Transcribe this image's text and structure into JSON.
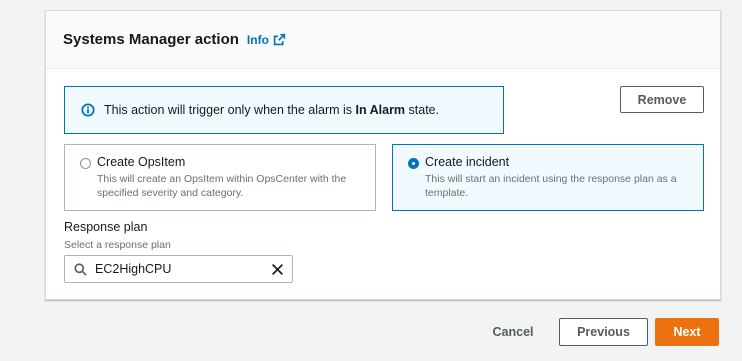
{
  "panel": {
    "title": "Systems Manager action",
    "info_link": "Info"
  },
  "alert": {
    "text_before": "This action will trigger only when the alarm is ",
    "text_bold": "In Alarm",
    "text_after": " state."
  },
  "remove_label": "Remove",
  "options": [
    {
      "title": "Create OpsItem",
      "description": "This will create an OpsItem within OpsCenter with the specified severity and category.",
      "selected": false
    },
    {
      "title": "Create incident",
      "description": "This will start an incident using the response plan as a template.",
      "selected": true
    }
  ],
  "response_plan": {
    "label": "Response plan",
    "description": "Select a response plan",
    "value": "EC2HighCPU"
  },
  "footer": {
    "cancel": "Cancel",
    "previous": "Previous",
    "next": "Next"
  },
  "colors": {
    "accent": "#0073bb",
    "primary_button": "#ec7211"
  }
}
